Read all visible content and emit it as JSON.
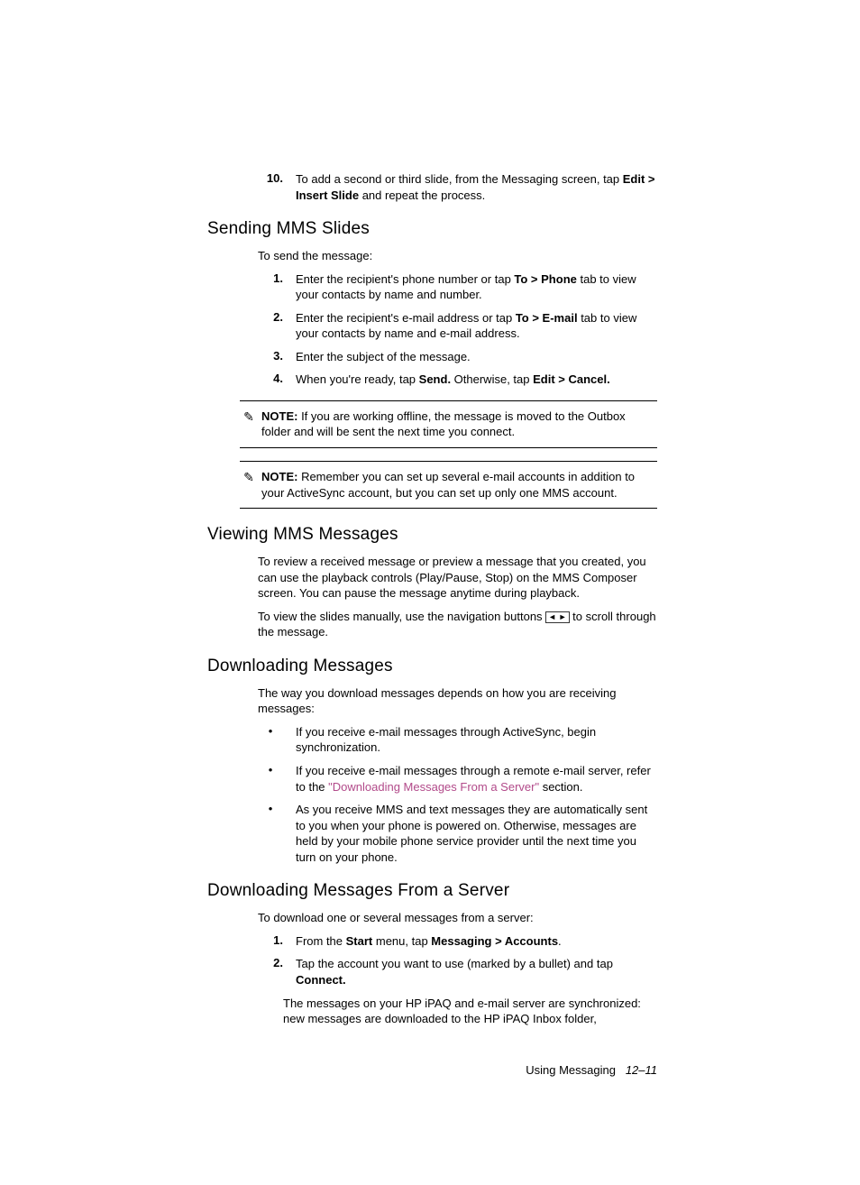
{
  "step10": {
    "num": "10.",
    "t1": "To add a second or third slide, from the Messaging screen, tap ",
    "b1": "Edit > Insert Slide",
    "t2": " and repeat the process."
  },
  "sec1": {
    "title": "Sending MMS Slides",
    "intro": "To send the message:",
    "steps": [
      {
        "num": "1.",
        "t1": "Enter the recipient's phone number or tap ",
        "b1": "To > Phone",
        "t2": " tab to view your contacts by name and number."
      },
      {
        "num": "2.",
        "t1": "Enter the recipient's e-mail address or tap ",
        "b1": "To > E-mail",
        "t2": " tab to view your contacts by name and e-mail address."
      },
      {
        "num": "3.",
        "t1": "Enter the subject of the message.",
        "b1": "",
        "t2": ""
      },
      {
        "num": "4.",
        "t1": "When you're ready, tap ",
        "b1": "Send.",
        "t2": " Otherwise, tap ",
        "b2": "Edit > Cancel."
      }
    ],
    "note1": {
      "label": "NOTE:",
      "text": " If you are working offline, the message is moved to the Outbox folder and will be sent the next time you connect."
    },
    "note2": {
      "label": "NOTE:",
      "text": " Remember you can set up several e-mail accounts in addition to your ActiveSync account, but you can set up only one MMS account."
    }
  },
  "sec2": {
    "title": "Viewing MMS Messages",
    "p1": "To review a received message or preview a message that you created, you can use the playback controls (Play/Pause, Stop) on the MMS Composer screen. You can pause the message anytime during playback.",
    "p2a": "To view the slides manually, use the navigation buttons ",
    "p2b": " to scroll through the message."
  },
  "sec3": {
    "title": "Downloading Messages",
    "intro": "The way you download messages depends on how you are receiving messages:",
    "bullets": [
      {
        "t1": "If you receive e-mail messages through ActiveSync, begin synchronization."
      },
      {
        "t1": "If you receive e-mail messages through a remote e-mail server, refer to the ",
        "link": "\"Downloading Messages From a Server\"",
        "t2": " section."
      },
      {
        "t1": "As you receive MMS and text messages they are automatically sent to you when your phone is powered on. Otherwise, messages are held by your mobile phone service provider until the next time you turn on your phone."
      }
    ]
  },
  "sec4": {
    "title": "Downloading Messages From a Server",
    "intro": "To download one or several messages from a server:",
    "steps": [
      {
        "num": "1.",
        "t1": "From the ",
        "b1": "Start",
        "t2": " menu, tap ",
        "b2": "Messaging > Accounts",
        "t3": "."
      },
      {
        "num": "2.",
        "t1": "Tap the account you want to use (marked by a bullet) and tap ",
        "b1": "Connect.",
        "t2": ""
      }
    ],
    "after": "The messages on your HP iPAQ and e-mail server are synchronized: new messages are downloaded to the HP iPAQ Inbox folder,"
  },
  "footer": {
    "text": "Using Messaging",
    "page": "12–11"
  },
  "icons": {
    "note": "✎",
    "bullet": "•",
    "navL": "◄",
    "navR": "►"
  }
}
